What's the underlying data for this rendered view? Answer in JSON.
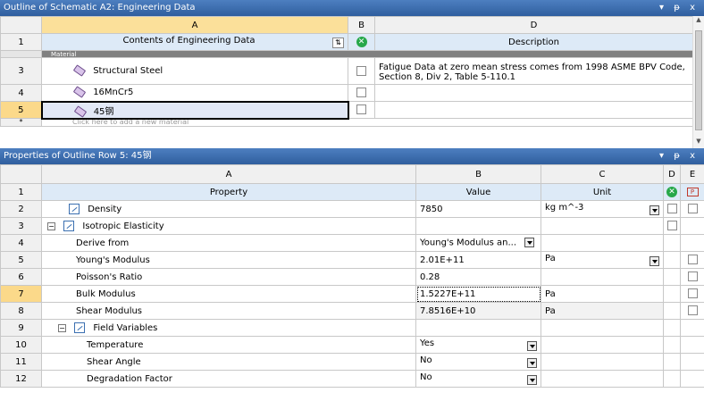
{
  "outline": {
    "title": "Outline of Schematic A2: Engineering Data",
    "controls": [
      "▾",
      "ᵽ",
      "x"
    ],
    "col_letters": [
      "A",
      "B",
      "D"
    ],
    "header": {
      "num": "1",
      "contents": "Contents of Engineering Data",
      "description": "Description"
    },
    "category_label": "Material",
    "rows": [
      {
        "num": "3",
        "name": "Structural Steel",
        "desc1": "Fatigue Data at zero mean stress comes from 1998 ASME BPV Code,",
        "desc2": "Section 8, Div 2, Table 5-110.1"
      },
      {
        "num": "4",
        "name": "16MnCr5",
        "desc1": "",
        "desc2": ""
      },
      {
        "num": "5",
        "name": "45钢",
        "desc1": "",
        "desc2": ""
      }
    ],
    "add_row_num": "*",
    "add_row_text": "Click here to add a new material"
  },
  "properties": {
    "title": "Properties of Outline Row 5: 45钢",
    "controls": [
      "▾",
      "ᵽ",
      "x"
    ],
    "col_letters": [
      "A",
      "B",
      "C",
      "D",
      "E"
    ],
    "header": {
      "num": "1",
      "property": "Property",
      "value": "Value",
      "unit": "Unit"
    },
    "rows": [
      {
        "num": "2",
        "label": "Density",
        "value": "7850",
        "unit": "kg m^-3"
      },
      {
        "num": "3",
        "label": "Isotropic Elasticity",
        "value": "",
        "unit": ""
      },
      {
        "num": "4",
        "label": "Derive from",
        "value": "Young's Modulus an...",
        "unit": ""
      },
      {
        "num": "5",
        "label": "Young's Modulus",
        "value": "2.01E+11",
        "unit": "Pa"
      },
      {
        "num": "6",
        "label": "Poisson's Ratio",
        "value": "0.28",
        "unit": ""
      },
      {
        "num": "7",
        "label": "Bulk Modulus",
        "value": "1.5227E+11",
        "unit": "Pa"
      },
      {
        "num": "8",
        "label": "Shear Modulus",
        "value": "7.8516E+10",
        "unit": "Pa"
      },
      {
        "num": "9",
        "label": "Field Variables",
        "value": "",
        "unit": ""
      },
      {
        "num": "10",
        "label": "Temperature",
        "value": "Yes",
        "unit": ""
      },
      {
        "num": "11",
        "label": "Shear Angle",
        "value": "No",
        "unit": ""
      },
      {
        "num": "12",
        "label": "Degradation Factor",
        "value": "No",
        "unit": ""
      }
    ]
  }
}
